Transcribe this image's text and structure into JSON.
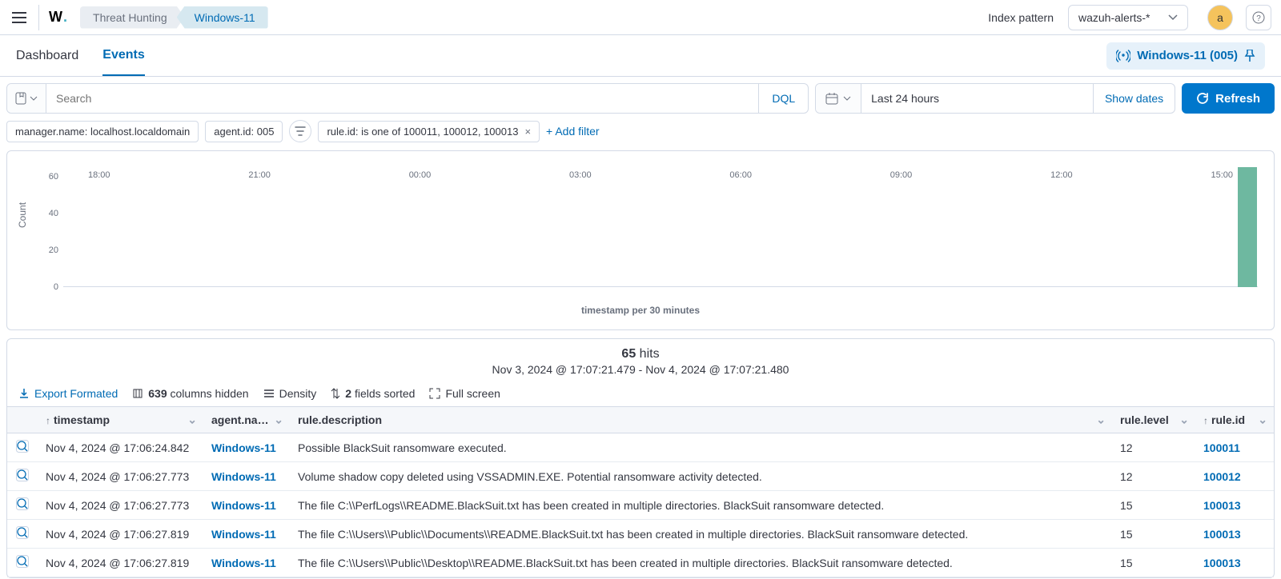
{
  "header": {
    "breadcrumb1": "Threat Hunting",
    "breadcrumb2": "Windows-11",
    "index_pattern_label": "Index pattern",
    "index_pattern_value": "wazuh-alerts-*",
    "avatar_letter": "a"
  },
  "subtabs": {
    "dashboard": "Dashboard",
    "events": "Events",
    "agent_badge": "Windows-11 (005)"
  },
  "query": {
    "search_placeholder": "Search",
    "dql_label": "DQL",
    "time_range": "Last 24 hours",
    "show_dates": "Show dates",
    "refresh": "Refresh"
  },
  "filters": {
    "items": [
      {
        "label": "manager.name: localhost.localdomain"
      },
      {
        "label": "agent.id: 005"
      },
      {
        "label": "rule.id: is one of 100011, 100012, 100013",
        "removable": true
      }
    ],
    "add_filter": "+ Add filter"
  },
  "chart_data": {
    "type": "bar",
    "title": "",
    "xlabel": "timestamp per 30 minutes",
    "ylabel": "Count",
    "ylim": [
      0,
      65
    ],
    "y_ticks": [
      0,
      20,
      40,
      60
    ],
    "x_ticks": [
      "18:00",
      "21:00",
      "00:00",
      "03:00",
      "06:00",
      "09:00",
      "12:00",
      "15:00"
    ],
    "values": [
      {
        "x_pct": 99.1,
        "value": 65
      }
    ]
  },
  "hits": {
    "count": "65",
    "count_suffix": " hits",
    "range": "Nov 3, 2024 @ 17:07:21.479 - Nov 4, 2024 @ 17:07:21.480",
    "toolbar": {
      "export": "Export Formated",
      "columns_hidden_n": "639",
      "columns_hidden_suffix": " columns hidden",
      "density": "Density",
      "fields_sorted_n": "2",
      "fields_sorted_suffix": " fields sorted",
      "full_screen": "Full screen"
    },
    "columns": {
      "timestamp": "timestamp",
      "agent": "agent.na…",
      "desc": "rule.description",
      "level": "rule.level",
      "id": "rule.id"
    },
    "rows": [
      {
        "ts": "Nov 4, 2024 @ 17:06:24.842",
        "agent": "Windows-11",
        "desc": "Possible BlackSuit ransomware executed.",
        "level": "12",
        "id": "100011"
      },
      {
        "ts": "Nov 4, 2024 @ 17:06:27.773",
        "agent": "Windows-11",
        "desc": "Volume shadow copy deleted using VSSADMIN.EXE. Potential ransomware activity detected.",
        "level": "12",
        "id": "100012"
      },
      {
        "ts": "Nov 4, 2024 @ 17:06:27.773",
        "agent": "Windows-11",
        "desc": "The file C:\\\\PerfLogs\\\\README.BlackSuit.txt has been created in multiple directories. BlackSuit ransomware detected.",
        "level": "15",
        "id": "100013"
      },
      {
        "ts": "Nov 4, 2024 @ 17:06:27.819",
        "agent": "Windows-11",
        "desc": "The file C:\\\\Users\\\\Public\\\\Documents\\\\README.BlackSuit.txt has been created in multiple directories. BlackSuit ransomware detected.",
        "level": "15",
        "id": "100013"
      },
      {
        "ts": "Nov 4, 2024 @ 17:06:27.819",
        "agent": "Windows-11",
        "desc": "The file C:\\\\Users\\\\Public\\\\Desktop\\\\README.BlackSuit.txt has been created in multiple directories. BlackSuit ransomware detected.",
        "level": "15",
        "id": "100013"
      }
    ]
  }
}
